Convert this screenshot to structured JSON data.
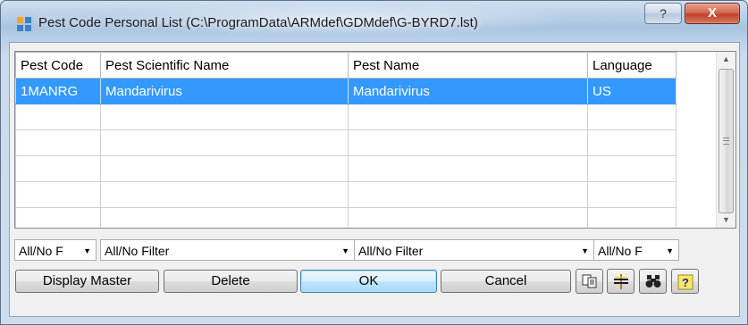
{
  "window": {
    "title": "Pest Code Personal List (C:\\ProgramData\\ARMdef\\GDMdef\\G-BYRD7.lst)",
    "help_label": "?",
    "close_label": "X"
  },
  "grid": {
    "columns": [
      "Pest Code",
      "Pest Scientific Name",
      "Pest Name",
      "Language"
    ],
    "rows": [
      [
        "1MANRG",
        "Mandarivirus",
        "Mandarivirus",
        "US"
      ]
    ],
    "selected_row": 0
  },
  "filters": [
    {
      "value": "All/No F"
    },
    {
      "value": "All/No Filter"
    },
    {
      "value": "All/No Filter"
    },
    {
      "value": "All/No F"
    }
  ],
  "buttons": {
    "display_master": "Display Master",
    "delete": "Delete",
    "ok": "OK",
    "cancel": "Cancel"
  },
  "icon_buttons": [
    "copy-icon",
    "column-width-icon",
    "binoculars-icon",
    "help-icon"
  ],
  "colors": {
    "selection": "#3399ff",
    "close": "#c7432c"
  }
}
